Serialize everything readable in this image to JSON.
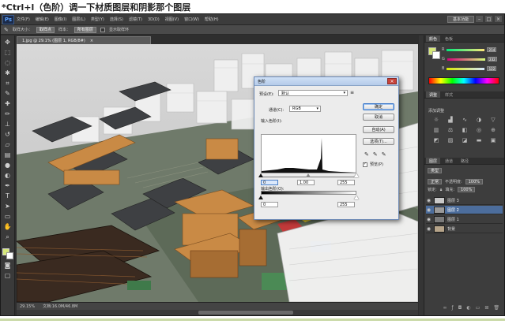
{
  "caption": "*Ctrl+l（色阶）调一下材质图层和阴影那个图层",
  "app": {
    "logo": "Ps",
    "menu": [
      "文件(F)",
      "编辑(E)",
      "图像(I)",
      "图层(L)",
      "类型(Y)",
      "选择(S)",
      "滤镜(T)",
      "3D(D)",
      "视图(V)",
      "窗口(W)",
      "帮助(H)"
    ],
    "workspace": "基本功能",
    "window_buttons": [
      "–",
      "□",
      "×"
    ]
  },
  "options": {
    "sample_size_label": "取样大小：",
    "sample_size_value": "取样点",
    "sample_label": "样本：",
    "sample_value": "所有图层",
    "show_ring_label": "显示取样环"
  },
  "document": {
    "tab": "1.jpg @ 29.1% (图层 1, RGB/8#)",
    "tab_close": "×",
    "zoom": "29.15%",
    "doc_info": "文档:16.0M/46.8M"
  },
  "levels": {
    "title": "色阶",
    "close": "×",
    "preset_label": "预设(E):",
    "preset_value": "默认",
    "channel_label": "通道(C):",
    "channel_value": "RGB",
    "input_label": "输入色阶(I):",
    "input_black": "0",
    "input_gamma": "1.00",
    "input_white": "255",
    "output_label": "输出色阶(O):",
    "output_black": "0",
    "output_white": "255",
    "buttons": {
      "ok": "确定",
      "cancel": "取消",
      "auto": "自动(A)",
      "options": "选项(T)..."
    },
    "preview_label": "预览(P)",
    "preview_checked": "✓"
  },
  "color_panel": {
    "tabs": [
      "颜色",
      "色板"
    ],
    "channels": [
      {
        "label": "R",
        "value": "214"
      },
      {
        "label": "G",
        "value": "232"
      },
      {
        "label": "B",
        "value": "122"
      }
    ],
    "foreground": "#d6e87a"
  },
  "adjustments": {
    "tabs": [
      "调整",
      "样式"
    ],
    "title": "添加调整"
  },
  "layers": {
    "tabs": [
      "图层",
      "通道",
      "路径"
    ],
    "filter": "类型",
    "blend_mode": "正常",
    "opacity_label": "不透明度:",
    "opacity_value": "100%",
    "lock_label": "锁定:",
    "fill_label": "填充:",
    "fill_value": "100%",
    "items": [
      {
        "name": "图层 3",
        "selected": false
      },
      {
        "name": "图层 2",
        "selected": true
      },
      {
        "name": "图层 1",
        "selected": false
      },
      {
        "name": "背景",
        "selected": false
      }
    ]
  }
}
